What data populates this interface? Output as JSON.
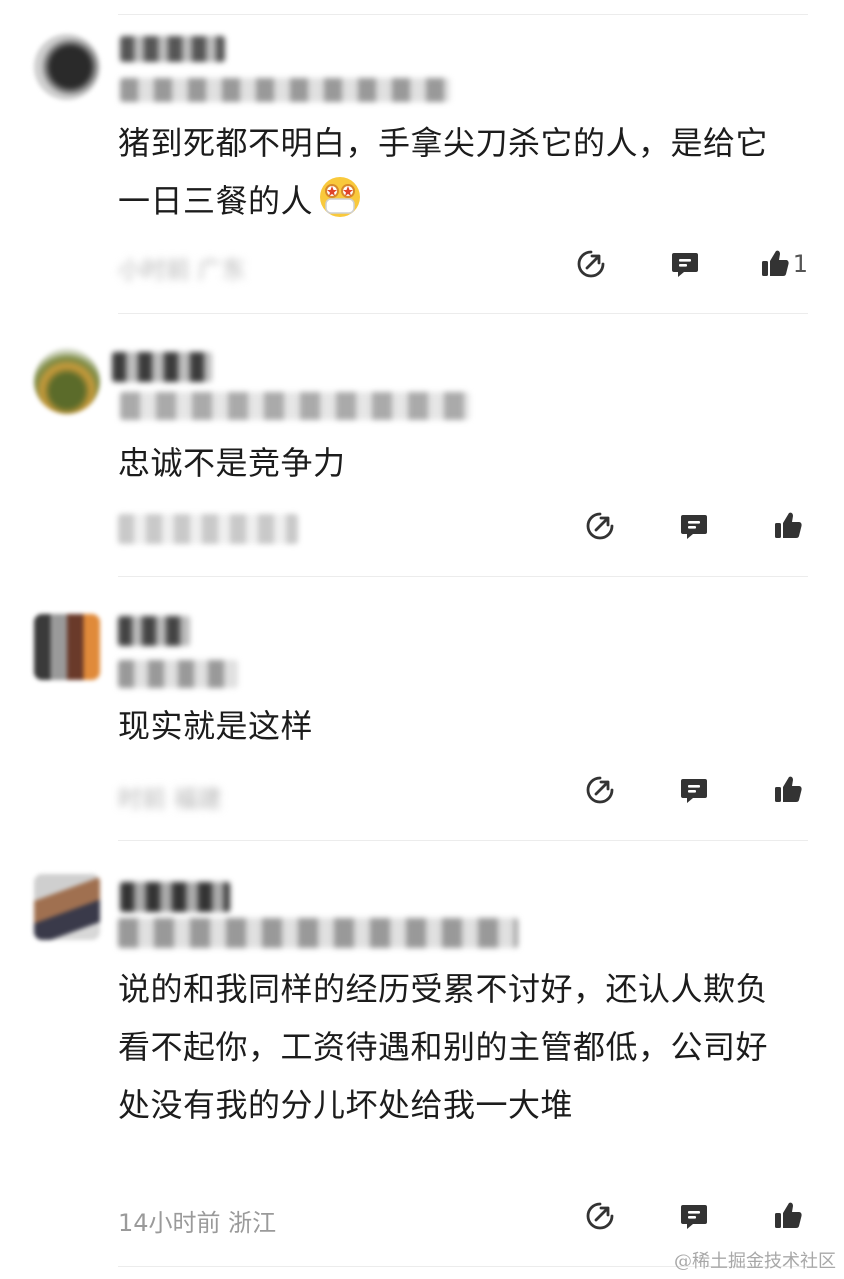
{
  "comments": [
    {
      "content": "猪到死都不明白，手拿尖刀杀它的人，是给它一日三餐的人",
      "emoji": "mask-face-emoji",
      "meta": "小时前 广东",
      "meta_blurred": true,
      "like_count": "1"
    },
    {
      "content": "忠诚不是竞争力",
      "meta": "",
      "meta_blurred": true,
      "like_count": ""
    },
    {
      "content": "现实就是这样",
      "meta": "时前 福建",
      "meta_blurred": true,
      "like_count": ""
    },
    {
      "content": "说的和我同样的经历受累不讨好，还认人欺负看不起你，工资待遇和别的主管都低，公司好处没有我的分儿坏处给我一大堆",
      "meta": "14小时前  浙江",
      "meta_blurred": false,
      "like_count": ""
    }
  ],
  "watermark": "@稀土掘金技术社区",
  "icons": {
    "share": "share-icon",
    "reply": "comment-icon",
    "like": "thumbs-up-icon"
  },
  "colors": {
    "icon": "#333333",
    "meta": "#9a9a9a",
    "divider": "#ececec"
  }
}
